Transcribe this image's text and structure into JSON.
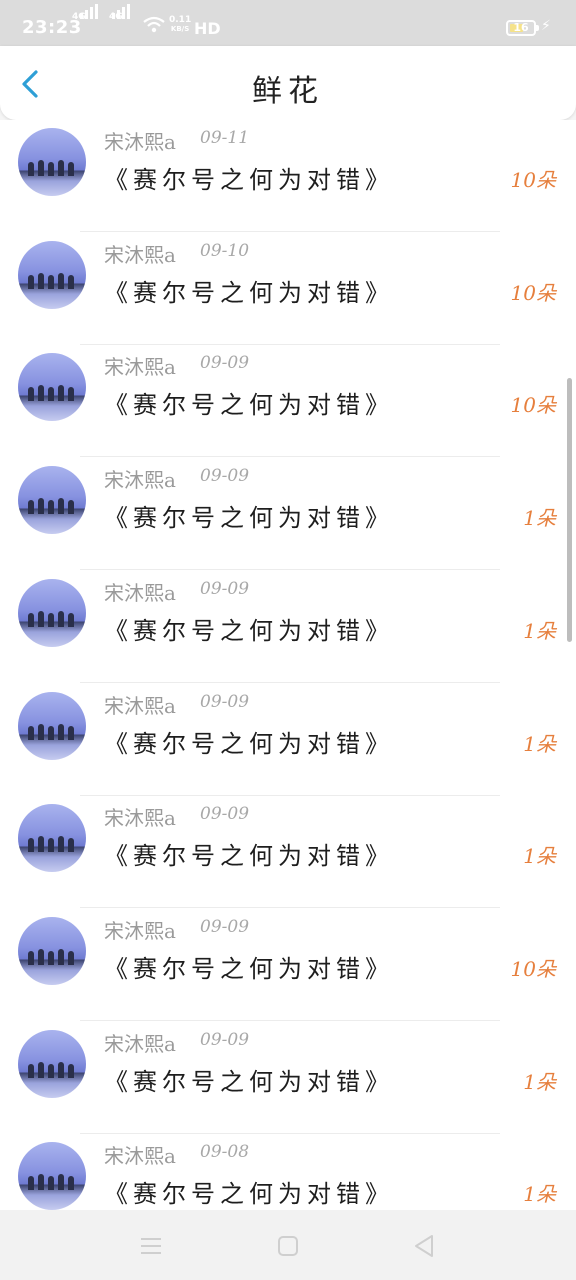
{
  "status_bar": {
    "time": "23:23",
    "net_type_1": "4G",
    "net_type_2": "4G",
    "speed_value": "0.11",
    "speed_unit": "KB/S",
    "hd_label": "HD",
    "battery_level": "16",
    "icons": [
      "signal-icon",
      "wifi-icon",
      "battery-icon",
      "charging-icon"
    ]
  },
  "header": {
    "title": "鲜花",
    "back_icon": "chevron-left-icon",
    "accent_color": "#2e9fd6"
  },
  "list": {
    "items": [
      {
        "user": "宋沐熙a",
        "date": "09-11",
        "work": "《赛尔号之何为对错》",
        "count": "10朵"
      },
      {
        "user": "宋沐熙a",
        "date": "09-10",
        "work": "《赛尔号之何为对错》",
        "count": "10朵"
      },
      {
        "user": "宋沐熙a",
        "date": "09-09",
        "work": "《赛尔号之何为对错》",
        "count": "10朵"
      },
      {
        "user": "宋沐熙a",
        "date": "09-09",
        "work": "《赛尔号之何为对错》",
        "count": "1朵"
      },
      {
        "user": "宋沐熙a",
        "date": "09-09",
        "work": "《赛尔号之何为对错》",
        "count": "1朵"
      },
      {
        "user": "宋沐熙a",
        "date": "09-09",
        "work": "《赛尔号之何为对错》",
        "count": "1朵"
      },
      {
        "user": "宋沐熙a",
        "date": "09-09",
        "work": "《赛尔号之何为对错》",
        "count": "1朵"
      },
      {
        "user": "宋沐熙a",
        "date": "09-09",
        "work": "《赛尔号之何为对错》",
        "count": "10朵"
      },
      {
        "user": "宋沐熙a",
        "date": "09-09",
        "work": "《赛尔号之何为对错》",
        "count": "1朵"
      },
      {
        "user": "宋沐熙a",
        "date": "09-08",
        "work": "《赛尔号之何为对错》",
        "count": "1朵"
      }
    ]
  },
  "nav_bar": {
    "icons": [
      "menu-icon",
      "home-icon",
      "back-icon"
    ]
  },
  "colors": {
    "count_color": "#e67f3d",
    "status_bar_bg": "#dcdcdc"
  }
}
